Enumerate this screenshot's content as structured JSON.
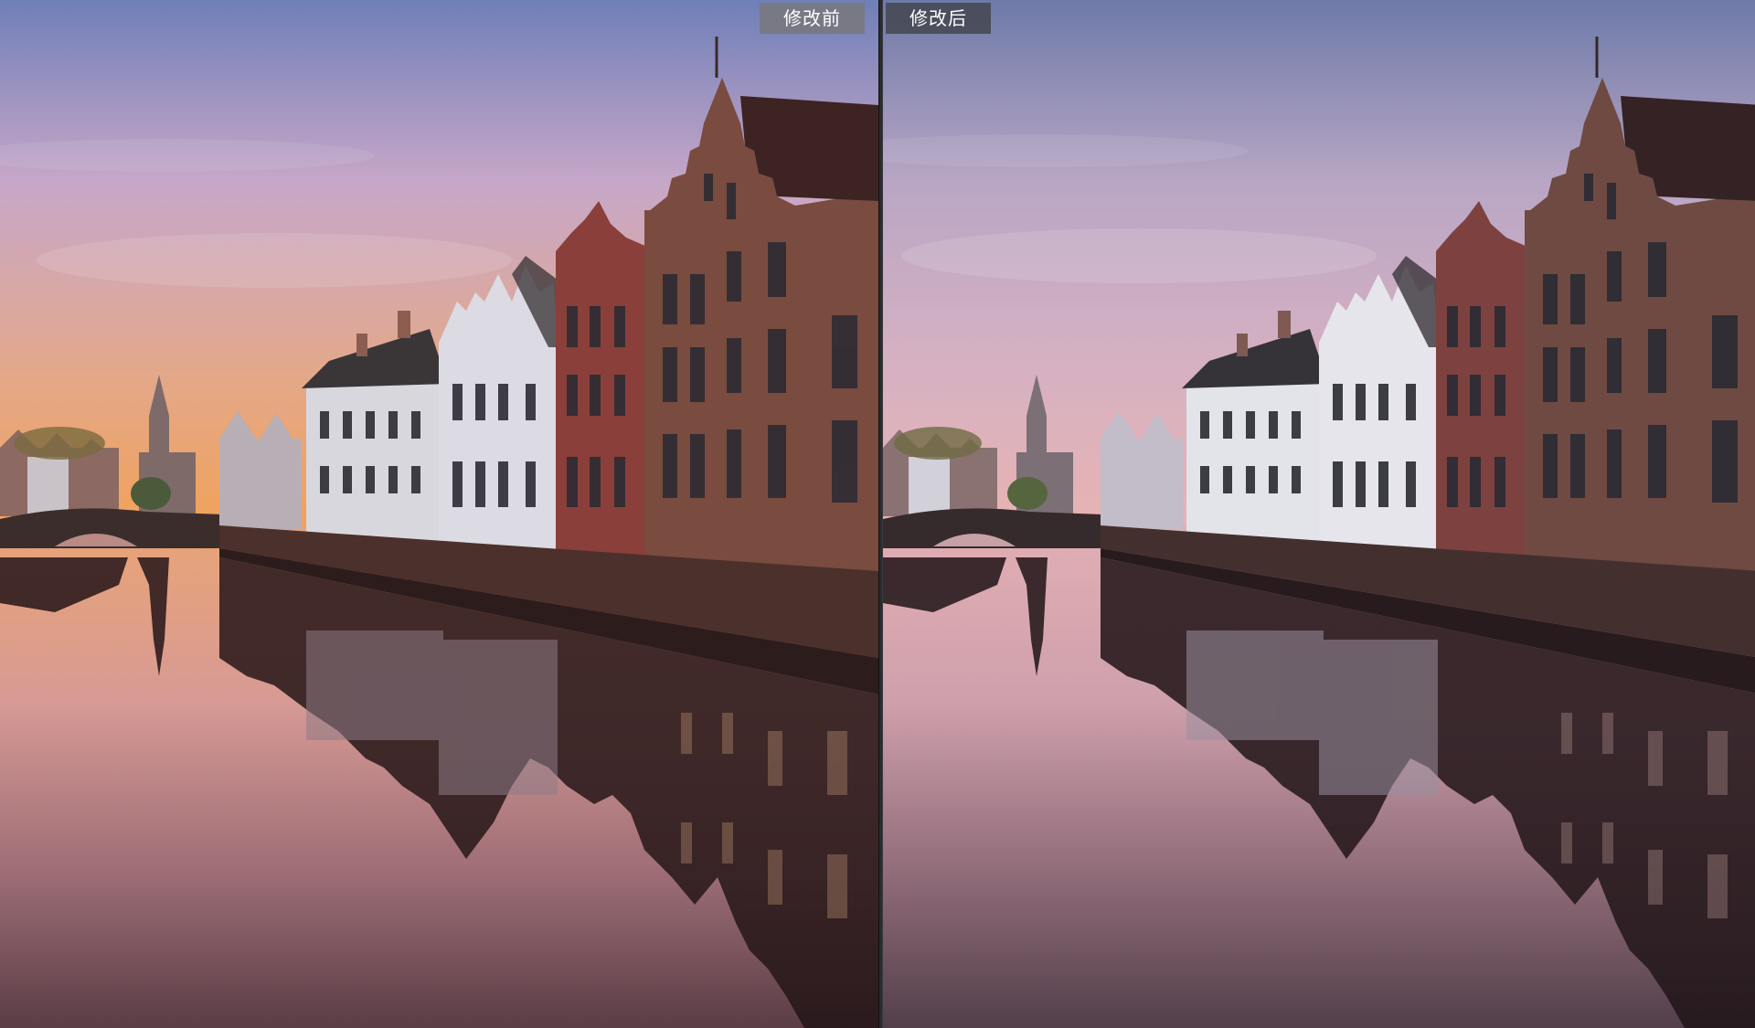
{
  "compare_view": {
    "before": {
      "label": "修改前",
      "colors": {
        "sky_top": "#6f7fb8",
        "sky_mid": "#c7a7c8",
        "horizon": "#f0a25a",
        "water_top": "#e9a476",
        "water_bottom": "#5a3d45",
        "brick": "#7a4b3f",
        "white_house": "#d9d7de"
      }
    },
    "after": {
      "label": "修改后",
      "colors": {
        "sky_top": "#6d7aa8",
        "sky_mid": "#b9a6c4",
        "horizon": "#e8b3b2",
        "water_top": "#e1aeb3",
        "water_bottom": "#523f4a",
        "brick": "#6f4a42",
        "white_house": "#e3e3ea"
      }
    },
    "divider": "drag-handle"
  }
}
